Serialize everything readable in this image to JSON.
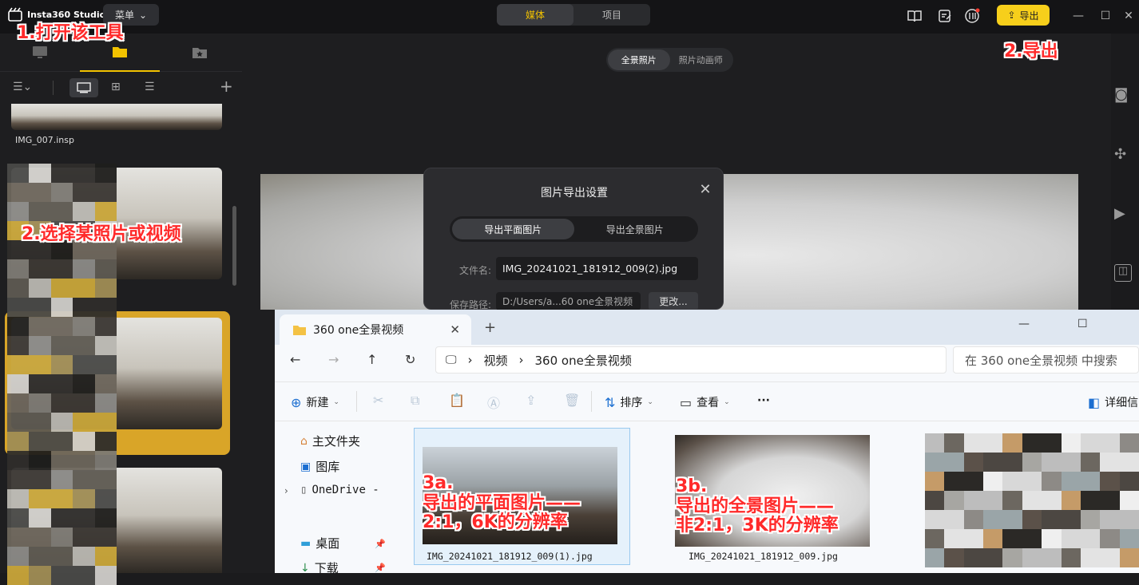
{
  "app": {
    "name": "Insta360 Studio",
    "menu_label": "菜单"
  },
  "top_tabs": [
    {
      "label": "媒体",
      "active": true
    },
    {
      "label": "项目",
      "active": false
    }
  ],
  "export_label": "导出",
  "sub_tabs": [
    {
      "label": "全景照片",
      "active": true
    },
    {
      "label": "照片动画师",
      "active": false
    }
  ],
  "sidebar": {
    "first_file": "IMG_007.insp"
  },
  "dialog": {
    "title": "图片导出设置",
    "tabs": [
      {
        "label": "导出平面图片",
        "active": true
      },
      {
        "label": "导出全景图片",
        "active": false
      }
    ],
    "filename_label": "文件名:",
    "filename_value": "IMG_20241021_181912_009(2).jpg",
    "path_label": "保存路径:",
    "path_value": "D:/Users/a...60 one全景视频",
    "change_label": "更改..."
  },
  "explorer": {
    "tab_title": "360 one全景视频",
    "breadcrumb": [
      "视频",
      "360 one全景视频"
    ],
    "search_placeholder": "在 360 one全景视频 中搜索",
    "commands": {
      "new": "新建",
      "sort": "排序",
      "view": "查看",
      "more": "···",
      "details": "详细信"
    },
    "nav": [
      {
        "label": "主文件夹",
        "icon": "home-icon"
      },
      {
        "label": "图库",
        "icon": "gallery-icon"
      },
      {
        "label": "OneDrive -",
        "icon": "document-icon"
      },
      {
        "label": "桌面",
        "icon": "desktop-icon"
      },
      {
        "label": "下载",
        "icon": "download-icon"
      }
    ],
    "files": [
      {
        "name": "IMG_20241021_181912_009(1).jpg",
        "selected": true
      },
      {
        "name": "IMG_20241021_181912_009.jpg",
        "selected": false
      }
    ]
  },
  "annotations": {
    "a1": "1.打开该工具",
    "a2": "2.导出",
    "a3": "2.选择某照片或视频",
    "a4": "3a.\n导出的平面图片——\n2:1，6K的分辨率",
    "a5": "3b.\n导出的全景图片——\n非2:1，3K的分辨率"
  },
  "colors": {
    "accent": "#f2c200",
    "export_button": "#f7cf1b",
    "annotation": "#ff2a2a"
  }
}
